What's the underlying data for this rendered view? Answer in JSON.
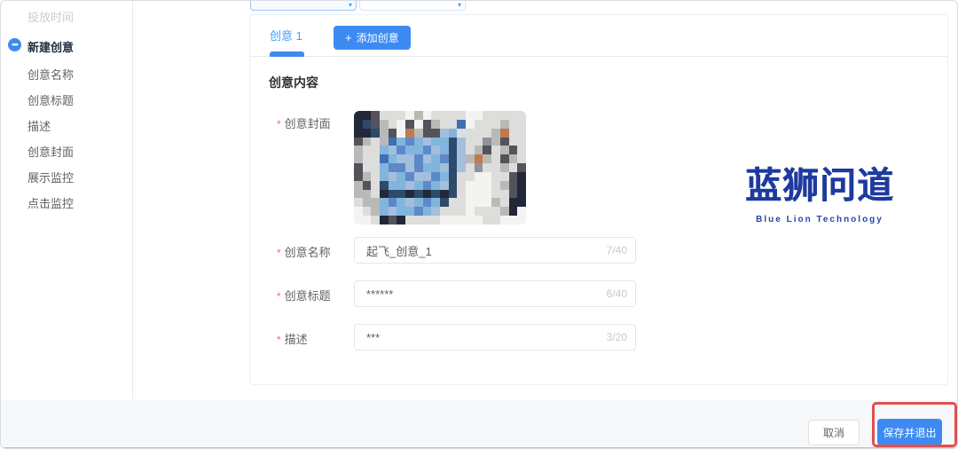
{
  "colors": {
    "accent_blue": "#3d8af2",
    "link_blue": "#409eff",
    "watermark_blue": "#1e3a9e",
    "annotation_red": "#df504d",
    "required_red": "#f56c6c",
    "disabled_gray": "#c8ccd4"
  },
  "sidebar": {
    "items": [
      {
        "label": "投放时间",
        "state": "disabled"
      },
      {
        "label": "新建创意",
        "state": "active",
        "icon": "ellipsis-step"
      },
      {
        "label": "创意名称",
        "state": "normal"
      },
      {
        "label": "创意标题",
        "state": "normal"
      },
      {
        "label": "描述",
        "state": "normal"
      },
      {
        "label": "创意封面",
        "state": "normal"
      },
      {
        "label": "展示监控",
        "state": "normal"
      },
      {
        "label": "点击监控",
        "state": "normal"
      }
    ]
  },
  "top_selects": {
    "chevron": "▾"
  },
  "tabs": {
    "active_label": "创意 1",
    "plus_icon": "+",
    "add_label": "添加创意"
  },
  "form": {
    "section_title": "创意内容",
    "fields": [
      {
        "label": "创意封面",
        "required": "*",
        "type": "image"
      },
      {
        "label": "创意名称",
        "required": "*",
        "value": "起飞_创意_1",
        "counter": "7/40"
      },
      {
        "label": "创意标题",
        "required": "*",
        "value": "******",
        "counter": "6/40"
      },
      {
        "label": "描述",
        "required": "*",
        "value": "***",
        "counter": "3/20"
      }
    ]
  },
  "cover_image": {
    "alt": "pixelated photo of a TV on a white media console",
    "palette": {
      "W": "#f3f3f1",
      "L": "#dddddb",
      "G": "#b9b9b7",
      "D": "#53535b",
      "N": "#22283a",
      "B": "#3f6fb5",
      "C": "#82b5dc",
      "T": "#5d89c9",
      "S": "#a4bedd",
      "A": "#c07a4e",
      "E": "#2e4a6b",
      "M": "#8d929d"
    },
    "rows": [
      "NNDLLLWGWLLLLWWLLLLL",
      "NEDGLWDWDGLLBWLLLGLL",
      "NNEGDWAGDDSCLLLLGALL",
      "DGLGBCTCSCCESLLMGDLL",
      "GLLCSTCCTSCESLGDLGDL",
      "GLLBCSSTSCTESGAGLDGL",
      "DLLCTTSTCCSESLMLLGLD",
      "DGLCSCTSSTCELLWWLLDN",
      "GDLECCSCTCSELWWWLGDN",
      "GGLNEENENENELWWWLLDN",
      "LGGCTCSCTCELLWWWGLNN",
      "WLGCSCCTCSLLLWLLLGNW",
      "WWLNDNLLLLWWWWWLLWWW"
    ]
  },
  "watermark": {
    "title": "蓝狮问道",
    "subtitle": "Blue Lion Technology"
  },
  "footer": {
    "cancel_label": "取消",
    "save_label": "保存并退出"
  }
}
